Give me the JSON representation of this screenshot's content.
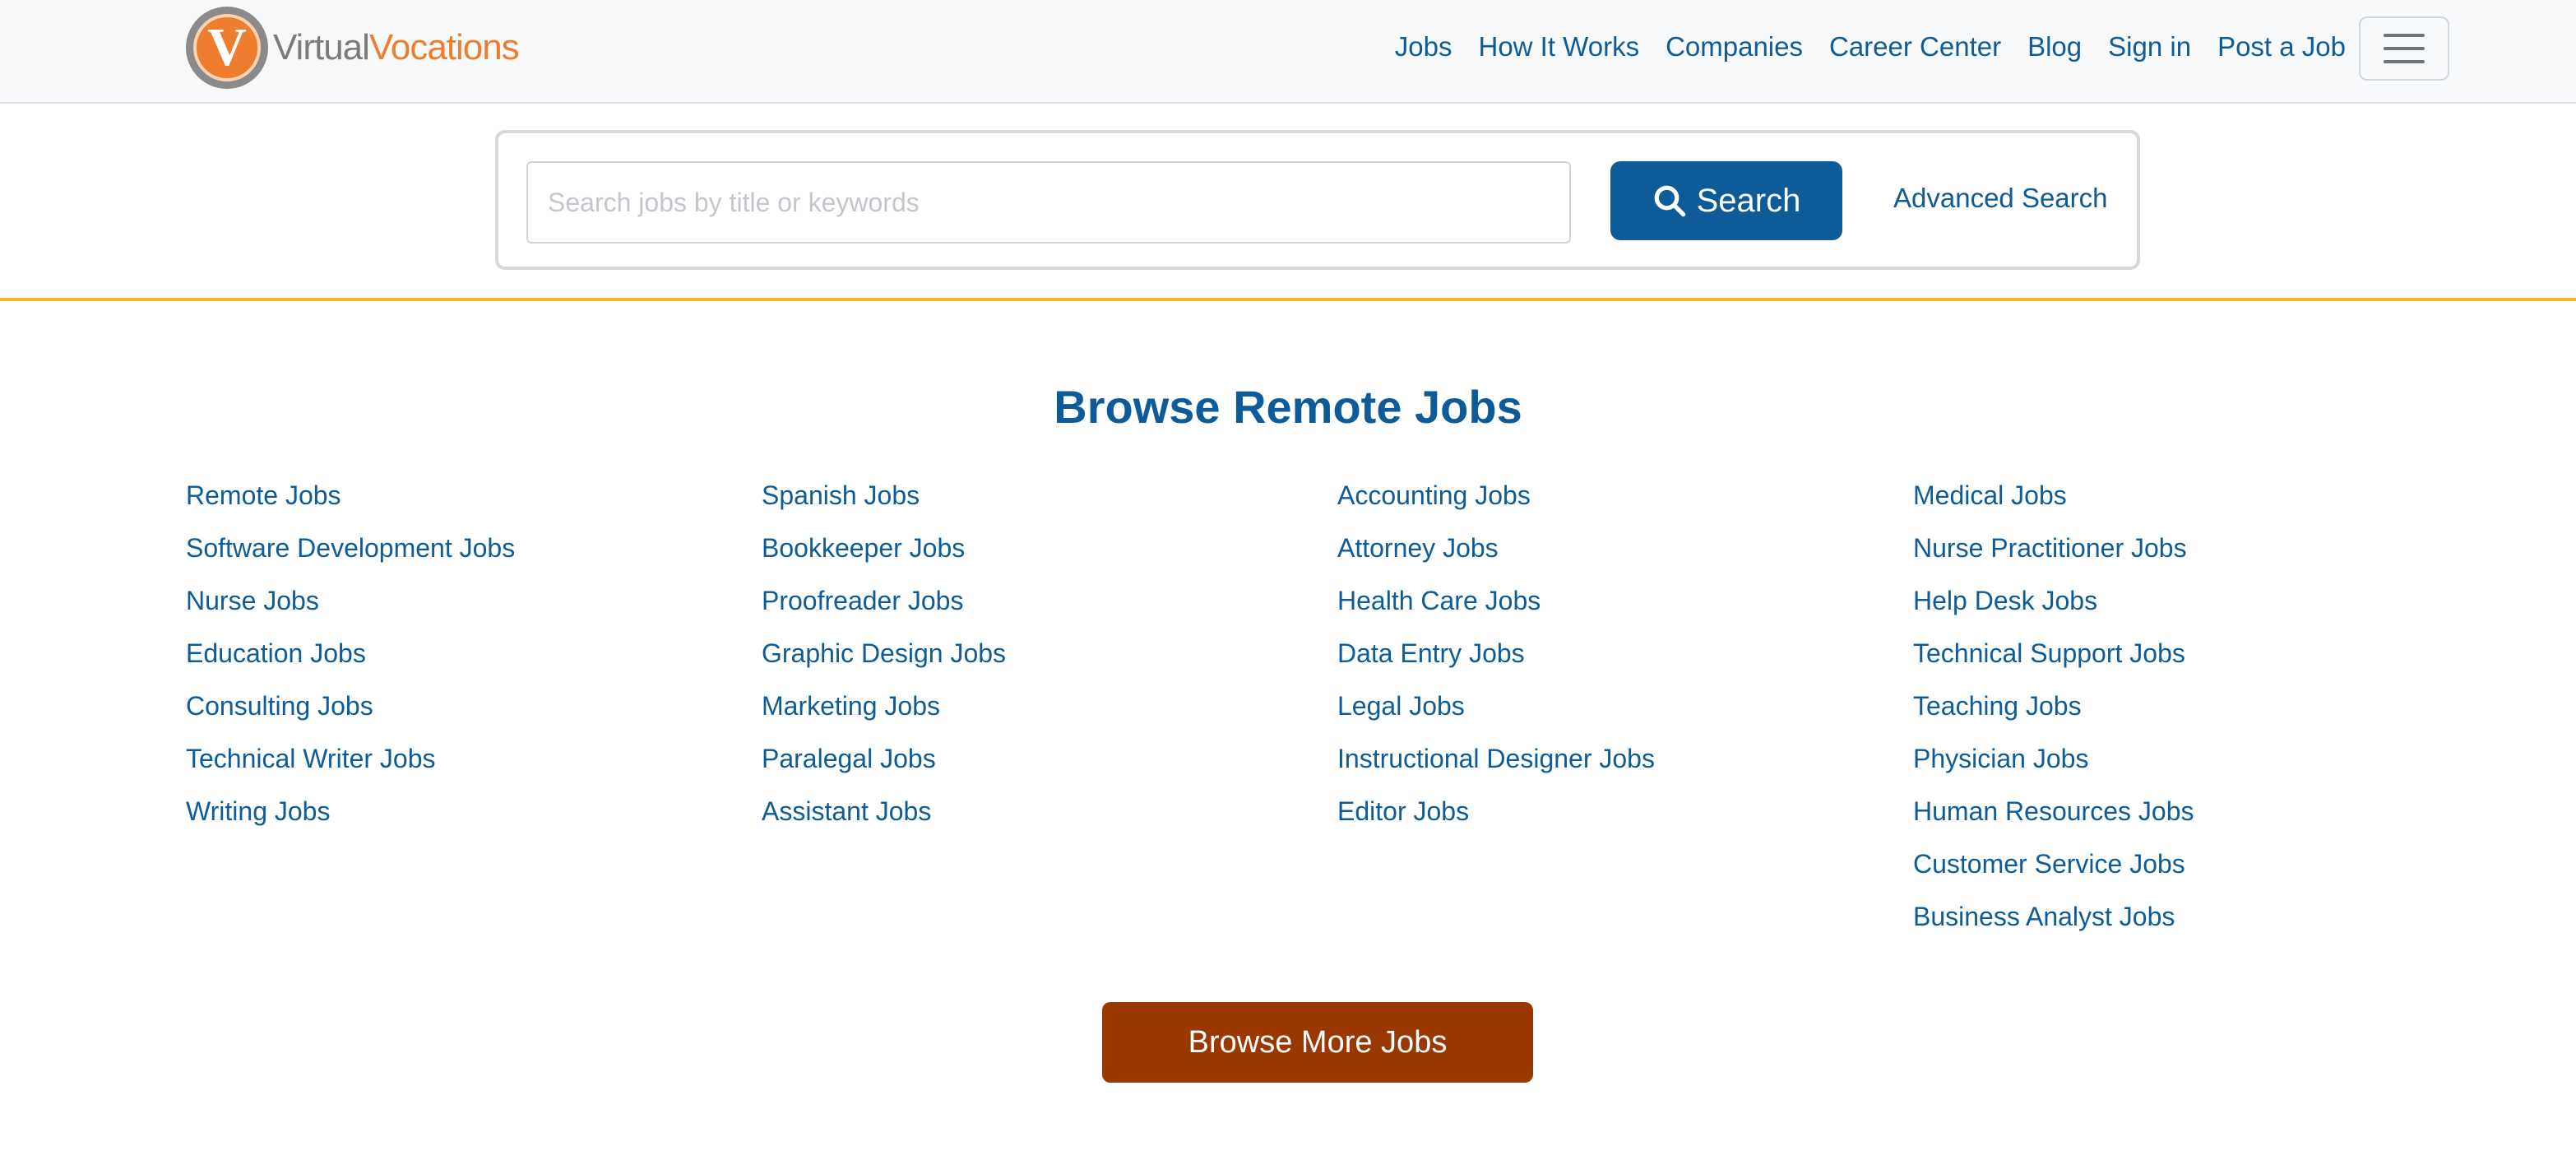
{
  "brand": {
    "part1": "Virtual",
    "part2": "Vocations",
    "logo_letter": "V"
  },
  "nav": {
    "items": [
      "Jobs",
      "How It Works",
      "Companies",
      "Career Center",
      "Blog",
      "Sign in",
      "Post a Job"
    ]
  },
  "search": {
    "placeholder": "Search jobs by title or keywords",
    "button_label": "Search",
    "advanced_label": "Advanced Search"
  },
  "browse": {
    "title": "Browse Remote Jobs",
    "columns": [
      [
        "Remote Jobs",
        "Software Development Jobs",
        "Nurse Jobs",
        "Education Jobs",
        "Consulting Jobs",
        "Technical Writer Jobs",
        "Writing Jobs"
      ],
      [
        "Spanish Jobs",
        "Bookkeeper Jobs",
        "Proofreader Jobs",
        "Graphic Design Jobs",
        "Marketing Jobs",
        "Paralegal Jobs",
        "Assistant Jobs"
      ],
      [
        "Accounting Jobs",
        "Attorney Jobs",
        "Health Care Jobs",
        "Data Entry Jobs",
        "Legal Jobs",
        "Instructional Designer Jobs",
        "Editor Jobs"
      ],
      [
        "Medical Jobs",
        "Nurse Practitioner Jobs",
        "Help Desk Jobs",
        "Technical Support Jobs",
        "Teaching Jobs",
        "Physician Jobs",
        "Human Resources Jobs",
        "Customer Service Jobs",
        "Business Analyst Jobs"
      ]
    ],
    "more_label": "Browse More Jobs"
  },
  "colors": {
    "link": "#0d5c99",
    "accent": "#ef7d2f",
    "divider": "#f5b921",
    "more_button": "#9b3700"
  }
}
